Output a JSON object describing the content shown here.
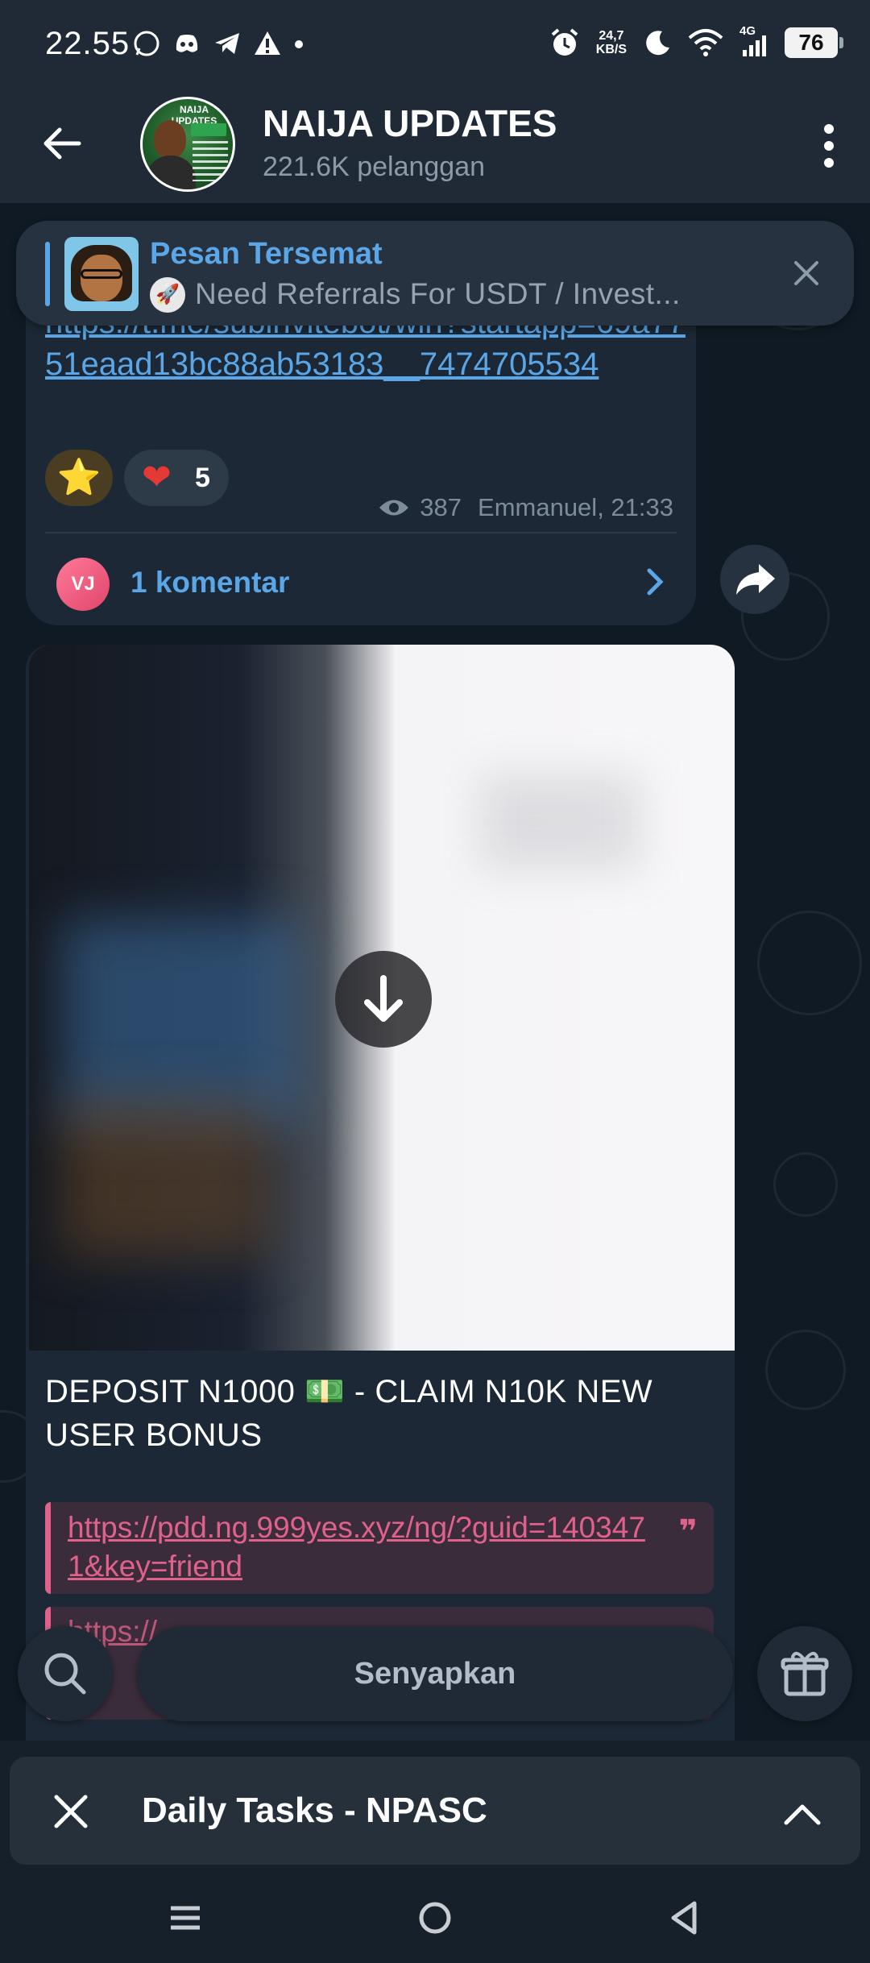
{
  "status_bar": {
    "time": "22.55",
    "net_speed_top": "24,7",
    "net_speed_bottom": "KB/S",
    "network_label": "4G",
    "battery": "76",
    "icons": [
      "whatsapp-icon",
      "discord-icon",
      "telegram-icon",
      "alert-icon",
      "dot-icon",
      "alarm-icon",
      "moon-icon",
      "wifi-icon",
      "signal-icon"
    ]
  },
  "header": {
    "title": "NAIJA UPDATES",
    "subtitle": "221.6K pelanggan",
    "avatar_text": "NAIJA UPDATES"
  },
  "pinned": {
    "title": "Pesan Tersemat",
    "text": "Need Referrals For USDT / Invest..."
  },
  "message1": {
    "link": "https://t.me/subinvitebot/win?startapp=69a7751eaad13bc88ab53183__7474705534",
    "reactions": {
      "star": "⭐",
      "heart": "❤",
      "heart_count": "5"
    },
    "views": "387",
    "author_time": "Emmanuel, 21:33",
    "comment_avatar": "VJ",
    "comment_label": "1 komentar"
  },
  "message2": {
    "caption": "DEPOSIT N1000 💵 - CLAIM N10K NEW USER BONUS",
    "quote_link": "https://pdd.ng.999yes.xyz/ng/?guid=1403471&key=friend",
    "quote_mark": "❞",
    "second_link_partial": "https://"
  },
  "bottom": {
    "mute_label": "Senyapkan"
  },
  "mini_app": {
    "title": "Daily Tasks - NPASC"
  },
  "colors": {
    "accent": "#5aa6e6",
    "quote": "#e0628a",
    "heart": "#e53935"
  }
}
